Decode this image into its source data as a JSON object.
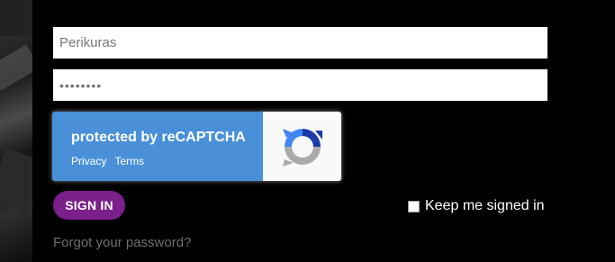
{
  "form": {
    "username_value": "Perikuras",
    "password_value": "••••••••",
    "signin_label": "SIGN IN",
    "keep_signed_in_label": "Keep me signed in",
    "keep_signed_in_checked": false,
    "forgot_password_label": "Forgot your password?"
  },
  "recaptcha": {
    "title": "protected by reCAPTCHA",
    "privacy_label": "Privacy",
    "terms_label": "Terms",
    "icon": "recaptcha-logo-icon"
  },
  "colors": {
    "background": "#000000",
    "signin_button": "#7b1f8a",
    "recaptcha_blue": "#4a90d9"
  }
}
